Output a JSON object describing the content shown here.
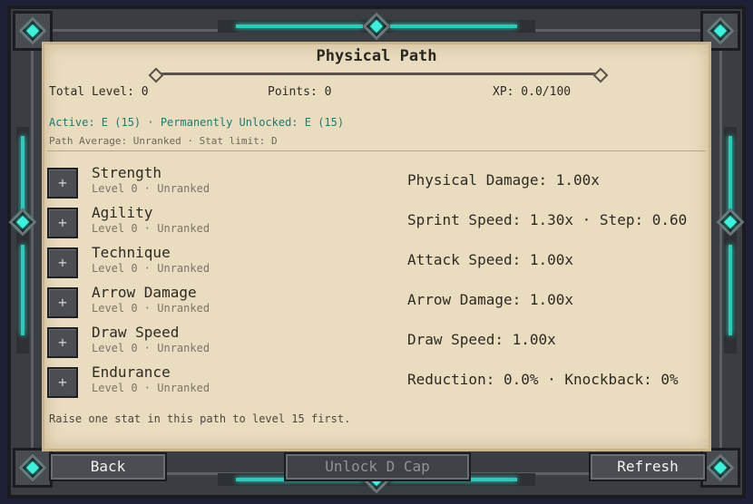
{
  "panel": {
    "title": "Physical Path",
    "total_level": "Total Level: 0",
    "points": "Points: 0",
    "xp": "XP: 0.0/100",
    "active_line": "Active: E (15) · Permanently Unlocked: E (15)",
    "avg_line": "Path Average: Unranked · Stat limit: D",
    "hint": "Raise one stat in this path to level 15 first."
  },
  "stats": [
    {
      "name": "Strength",
      "sub": "Level 0 · Unranked",
      "effect": "Physical Damage: 1.00x",
      "button": "+"
    },
    {
      "name": "Agility",
      "sub": "Level 0 · Unranked",
      "effect": "Sprint Speed: 1.30x · Step: 0.60",
      "button": "+"
    },
    {
      "name": "Technique",
      "sub": "Level 0 · Unranked",
      "effect": "Attack Speed: 1.00x",
      "button": "+"
    },
    {
      "name": "Arrow Damage",
      "sub": "Level 0 · Unranked",
      "effect": "Arrow Damage: 1.00x",
      "button": "+"
    },
    {
      "name": "Draw Speed",
      "sub": "Level 0 · Unranked",
      "effect": "Draw Speed: 1.00x",
      "button": "+"
    },
    {
      "name": "Endurance",
      "sub": "Level 0 · Unranked",
      "effect": "Reduction: 0.0% · Knockback: 0%",
      "button": "+"
    }
  ],
  "buttons": {
    "back": "Back",
    "unlock": "Unlock D Cap",
    "refresh": "Refresh"
  },
  "colors": {
    "parchment": "#e9dcbf",
    "frame": "#3a3d41",
    "accent_gem": "#3ff0dc",
    "active_text": "#1f7a72"
  }
}
